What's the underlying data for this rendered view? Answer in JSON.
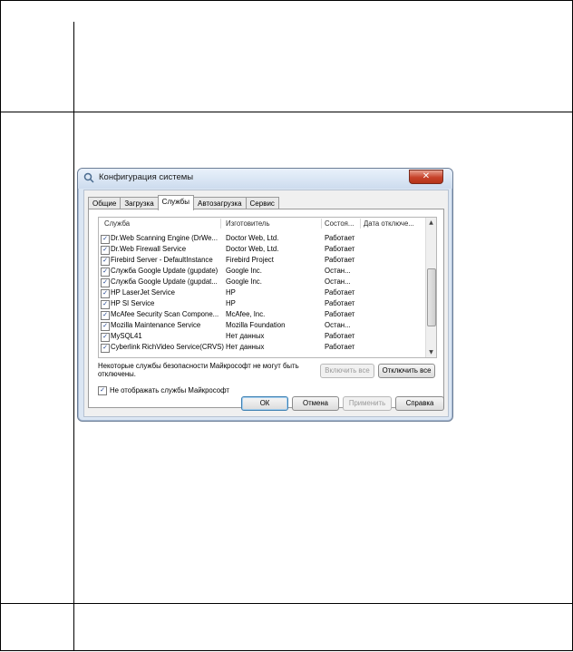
{
  "dialog": {
    "title": "Конфигурация системы",
    "close_label": "✕",
    "tabs": [
      "Общие",
      "Загрузка",
      "Службы",
      "Автозагрузка",
      "Сервис"
    ],
    "active_tab": "Службы",
    "columns": [
      "Служба",
      "Изготовитель",
      "Состоя...",
      "Дата отключе..."
    ],
    "rows": [
      {
        "name": "Dr.Web Scanning Engine (DrWe...",
        "vendor": "Doctor Web, Ltd.",
        "status": "Работает"
      },
      {
        "name": "Dr.Web Firewall Service",
        "vendor": "Doctor Web, Ltd.",
        "status": "Работает"
      },
      {
        "name": "Firebird Server - DefaultInstance",
        "vendor": "Firebird Project",
        "status": "Работает"
      },
      {
        "name": "Служба Google Update (gupdate)",
        "vendor": "Google Inc.",
        "status": "Остан..."
      },
      {
        "name": "Служба Google Update (gupdat...",
        "vendor": "Google Inc.",
        "status": "Остан..."
      },
      {
        "name": "HP LaserJet Service",
        "vendor": "HP",
        "status": "Работает"
      },
      {
        "name": "HP SI Service",
        "vendor": "HP",
        "status": "Работает"
      },
      {
        "name": "McAfee Security Scan Compone...",
        "vendor": "McAfee, Inc.",
        "status": "Работает"
      },
      {
        "name": "Mozilla Maintenance Service",
        "vendor": "Mozilla Foundation",
        "status": "Остан..."
      },
      {
        "name": "MySQL41",
        "vendor": "Нет данных",
        "status": "Работает"
      },
      {
        "name": "Cyberlink RichVideo Service(CRVS)",
        "vendor": "Нет данных",
        "status": "Работает"
      }
    ],
    "note": "Некоторые службы безопасности Майкрософт не могут быть отключены.",
    "enable_all": "Включить все",
    "disable_all": "Отключить все",
    "hide_ms_label": "Не отображать службы Майкрософт",
    "ok": "ОК",
    "cancel": "Отмена",
    "apply": "Применить",
    "help": "Справка",
    "check_mark": "✓",
    "scroll_up": "▲",
    "scroll_down": "▼"
  }
}
